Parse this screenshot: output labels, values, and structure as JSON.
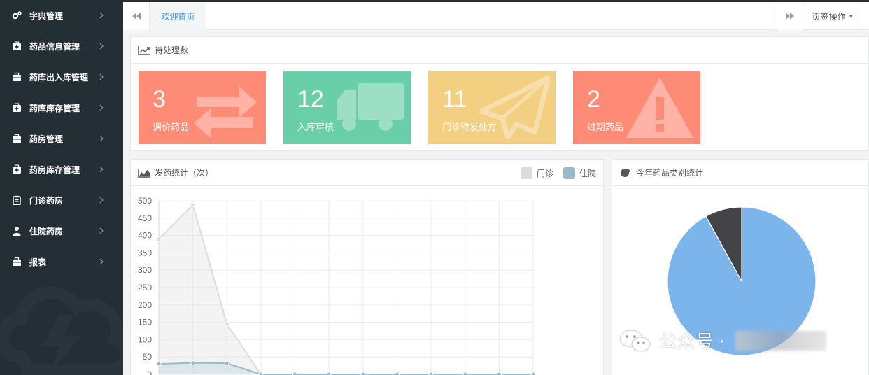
{
  "sidebar": {
    "items": [
      {
        "label": "字典管理",
        "icon": "gears-icon"
      },
      {
        "label": "药品信息管理",
        "icon": "medkit-icon"
      },
      {
        "label": "药库出入库管理",
        "icon": "briefcase-icon"
      },
      {
        "label": "药库库存管理",
        "icon": "medkit-icon"
      },
      {
        "label": "药房管理",
        "icon": "briefcase-icon"
      },
      {
        "label": "药房库存管理",
        "icon": "medkit-icon"
      },
      {
        "label": "门诊药房",
        "icon": "clipboard-icon"
      },
      {
        "label": "住院药房",
        "icon": "user-md-icon"
      },
      {
        "label": "报表",
        "icon": "briefcase-icon"
      }
    ]
  },
  "topbar": {
    "tab_label": "欢迎首页",
    "tab_ops_label": "页签操作"
  },
  "pending": {
    "title": "待处理数",
    "cards": [
      {
        "count": "3",
        "label": "调价药品",
        "color": "#fe8b76",
        "icon": "exchange-icon"
      },
      {
        "count": "12",
        "label": "入库审核",
        "color": "#68cfa8",
        "icon": "truck-icon"
      },
      {
        "count": "11",
        "label": "门诊待发处方",
        "color": "#f3cf82",
        "icon": "paper-plane-icon"
      },
      {
        "count": "2",
        "label": "过期药品",
        "color": "#fe8b76",
        "icon": "warning-icon"
      }
    ]
  },
  "stat": {
    "title": "发药统计（次）",
    "legend": [
      {
        "name": "门诊",
        "color": "#dcdcdc"
      },
      {
        "name": "住院",
        "color": "#97bbcd"
      }
    ]
  },
  "pie": {
    "title": "今年药品类别统计"
  },
  "watermark": {
    "text": "公众号 ·"
  },
  "chart_data": [
    {
      "type": "line",
      "title": "发药统计（次）",
      "ylim": [
        0,
        500
      ],
      "yticks": [
        0,
        50,
        100,
        150,
        200,
        250,
        300,
        350,
        400,
        450,
        500
      ],
      "grid": true,
      "legend_position": "top-right",
      "x_count": 12,
      "series": [
        {
          "name": "门诊",
          "color": "#dcdcdc",
          "values": [
            390,
            488,
            145,
            0,
            0,
            0,
            0,
            0,
            0,
            0,
            0,
            0
          ]
        },
        {
          "name": "住院",
          "color": "#97bbcd",
          "values": [
            30,
            33,
            32,
            0,
            0,
            0,
            0,
            0,
            0,
            0,
            0,
            0
          ]
        }
      ]
    },
    {
      "type": "pie",
      "title": "今年药品类别统计",
      "slices": [
        {
          "value": 92,
          "color": "#7cb5ec"
        },
        {
          "value": 8,
          "color": "#434348"
        }
      ]
    }
  ]
}
